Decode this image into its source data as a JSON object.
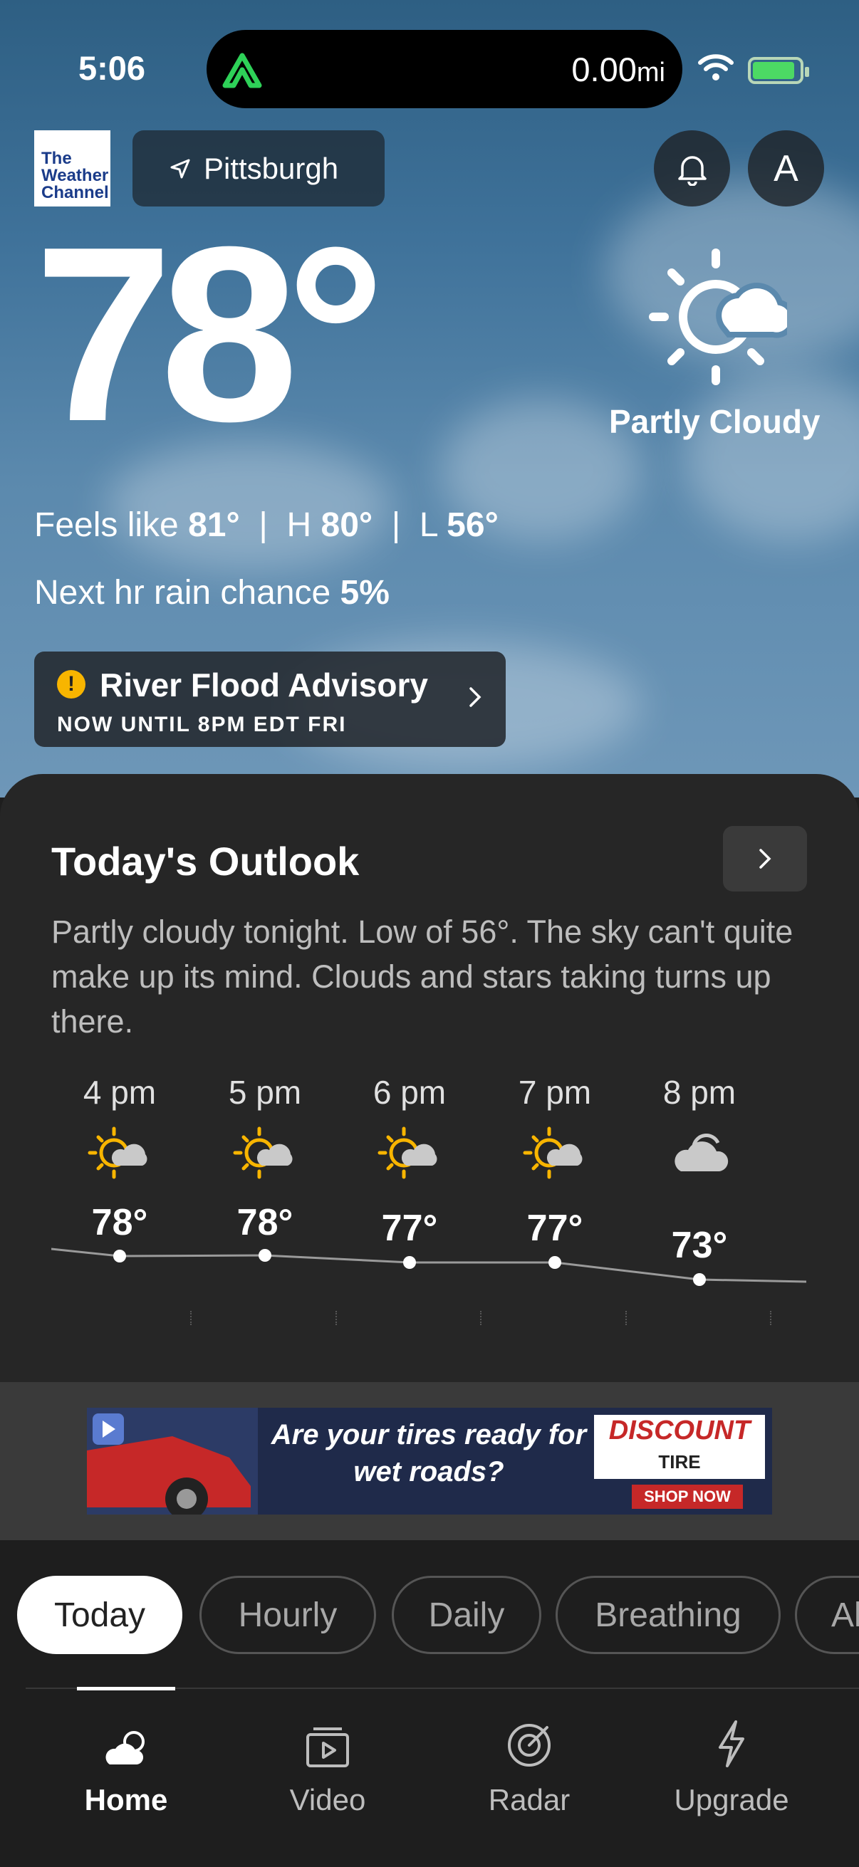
{
  "status_bar": {
    "time": "5:06",
    "distance_value": "0.00",
    "distance_unit": "mi"
  },
  "header": {
    "logo_text": [
      "The",
      "Weather",
      "Channel"
    ],
    "location": "Pittsburgh",
    "avatar_letter": "A"
  },
  "current": {
    "temperature": "78°",
    "condition": "Partly Cloudy",
    "feels_label": "Feels like",
    "feels_value": "81°",
    "high_label": "H",
    "high_value": "80°",
    "low_label": "L",
    "low_value": "56°",
    "rain_label": "Next hr rain chance",
    "rain_value": "5%"
  },
  "alert": {
    "title": "River Flood Advisory",
    "subtitle": "NOW UNTIL 8PM EDT FRI",
    "color": "#f8b500"
  },
  "outlook": {
    "title": "Today's Outlook",
    "description": "Partly cloudy tonight. Low of 56°. The sky can't quite make up its mind. Clouds and stars taking turns up there.",
    "hours": [
      {
        "time": "4 pm",
        "icon": "partly-sunny-icon",
        "temp": "78°"
      },
      {
        "time": "5 pm",
        "icon": "partly-sunny-icon",
        "temp": "78°"
      },
      {
        "time": "6 pm",
        "icon": "partly-sunny-icon",
        "temp": "77°"
      },
      {
        "time": "7 pm",
        "icon": "partly-sunny-icon",
        "temp": "77°"
      },
      {
        "time": "8 pm",
        "icon": "cloudy-icon",
        "temp": "73°"
      }
    ]
  },
  "ad": {
    "headline": "Are your tires ready for wet roads?",
    "brand": "DISCOUNT",
    "brand_sub": "TIRE",
    "cta": "SHOP NOW"
  },
  "chips": [
    "Today",
    "Hourly",
    "Daily",
    "Breathing",
    "Al"
  ],
  "nav": [
    "Home",
    "Video",
    "Radar",
    "Upgrade"
  ],
  "colors": {
    "sun": "#f8b500",
    "card": "#262626",
    "background": "#1e1e1e"
  }
}
